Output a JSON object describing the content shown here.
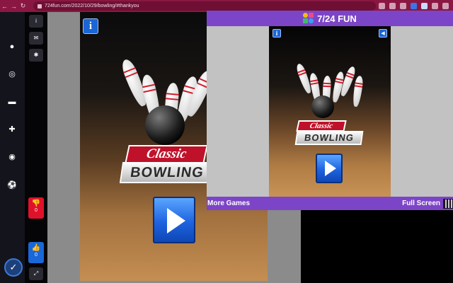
{
  "browser": {
    "url": "724fun.com/2022/10/29/bowling/#thankyou",
    "back_icon": "arrow-left-icon",
    "forward_icon": "arrow-right-icon",
    "reload_icon": "reload-icon"
  },
  "sidebar": {
    "items": [
      {
        "icon": "bomb-icon",
        "glyph": "●"
      },
      {
        "icon": "gamepad-icon",
        "glyph": "◎"
      },
      {
        "icon": "car-icon",
        "glyph": "▬"
      },
      {
        "icon": "puzzle-icon",
        "glyph": "✚"
      },
      {
        "icon": "target-icon",
        "glyph": "◉"
      },
      {
        "icon": "soccer-ball-icon",
        "glyph": "⚽"
      }
    ],
    "logo_icon": "site-logo-icon"
  },
  "tools": {
    "info_glyph": "i",
    "comment_glyph": "✉",
    "bug_glyph": "✱",
    "fullscreen_glyph": "⤢",
    "dislike_count": "0",
    "like_count": "0"
  },
  "game": {
    "title_line1": "Classic",
    "title_line2": "BOWLING",
    "info_glyph": "i"
  },
  "popup": {
    "title": "7/24 FUN",
    "more_games": "More Games",
    "full_screen": "Full Screen",
    "sound_glyph": "◀"
  },
  "colors": {
    "browser_bar": "#8a1742",
    "popup_accent": "#7c45c7",
    "play_blue": "#1e63e0",
    "dislike_red": "#e0112b",
    "like_blue": "#1967d8"
  }
}
